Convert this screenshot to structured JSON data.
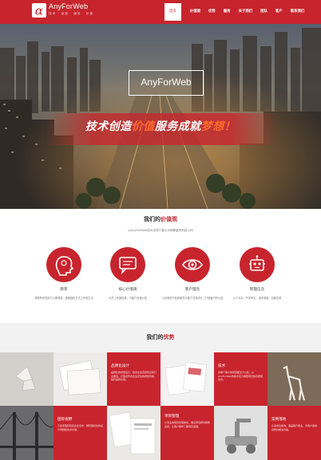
{
  "brand": {
    "name": "AnyForWeb",
    "sub": "技术 · 创造 · 服务 · 价值",
    "accent": "#c8242d"
  },
  "nav": {
    "items": [
      "首页",
      "价值观",
      "优势",
      "服务",
      "关于我们",
      "团队",
      "客户",
      "联系我们"
    ]
  },
  "hero": {
    "box_text": "AnyForWeb",
    "slogan_a": "技术创造",
    "slogan_b": "价值",
    "slogan_c": "服务成就",
    "slogan_d": "梦想！"
  },
  "values_section": {
    "title_a": "我们的",
    "title_b": "价值观",
    "subtitle": "以AnyForWeb成为全球广度认可和尊重的科技公司",
    "items": [
      {
        "icon": "head-icon",
        "title": "愿景",
        "desc": "帮助所有的用户以更简单、更便捷的方式工作和生活"
      },
      {
        "icon": "chat-icon",
        "title": "核心价值观",
        "desc": "为员工创造机遇，为客户创造价值"
      },
      {
        "icon": "eye-icon",
        "title": "客户理念",
        "desc": "以优秀的产品和服务与客户共同成长，打造客户的价值"
      },
      {
        "icon": "robot-icon",
        "title": "管理信念",
        "desc": "以人为本，严谨求实，追求卓越，创新变革"
      }
    ]
  },
  "adv_section": {
    "title_a": "我们的",
    "title_b": "优势",
    "tiles": [
      {
        "title": "品牌化设计",
        "text": "品牌化的视觉设计，结合企业自身特点和行业属性，打造出符合企业定位的视觉风格，提升品牌价值。"
      },
      {
        "title": "技术",
        "text": "对每个客户的项目都全力以赴，以AnyForWeb的技术实力保障项目的高质量交付。"
      },
      {
        "title": "国际视野",
        "text": "与多家国际知名企业合作，拥有国际化的设计视野和技术标准。"
      },
      {
        "title": "项目管理",
        "text": "以专业的项目管理体系，保证项目按时按质完成，让客户随时了解项目进展。"
      },
      {
        "title": "案例落地",
        "text": "众多成功案例，涵盖各行各业，为客户提供完整的解决方案。"
      }
    ]
  }
}
